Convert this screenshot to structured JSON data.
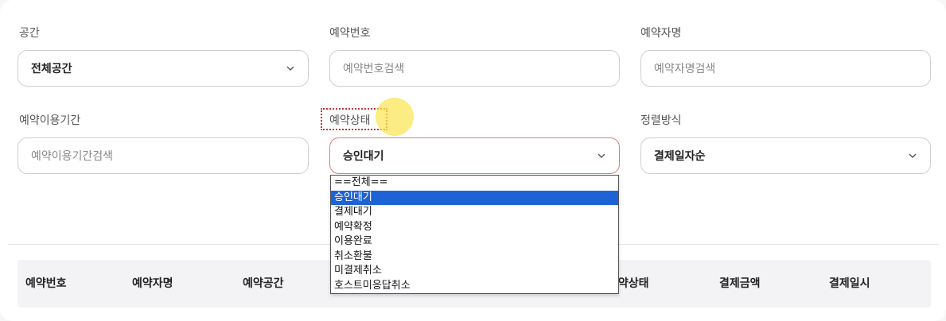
{
  "filters": {
    "space": {
      "label": "공간",
      "value": "전체공간",
      "icon": "chevron-down-icon"
    },
    "reservation_number": {
      "label": "예약번호",
      "placeholder": "예약번호검색"
    },
    "reserver_name": {
      "label": "예약자명",
      "placeholder": "예약자명검색"
    },
    "usage_period": {
      "label": "예약이용기간",
      "placeholder": "예약이용기간검색"
    },
    "status": {
      "label": "예약상태",
      "value": "승인대기",
      "icon": "chevron-down-icon"
    },
    "sort": {
      "label": "정렬방식",
      "value": "결제일자순",
      "icon": "chevron-down-icon"
    }
  },
  "status_dropdown": {
    "options": [
      "==전체==",
      "승인대기",
      "결제대기",
      "예약확정",
      "이용완료",
      "취소환불",
      "미결제취소",
      "호스트미응답취소"
    ],
    "selected": "승인대기"
  },
  "table": {
    "headers": [
      "예약번호",
      "예약자명",
      "예약공간",
      "예약상태",
      "결제금액",
      "결제일시"
    ]
  },
  "colors": {
    "focused_border": "#e07c7c",
    "selected_option": "#1e63d6",
    "highlight_outline": "#d23030",
    "cursor": "#fae65a"
  }
}
